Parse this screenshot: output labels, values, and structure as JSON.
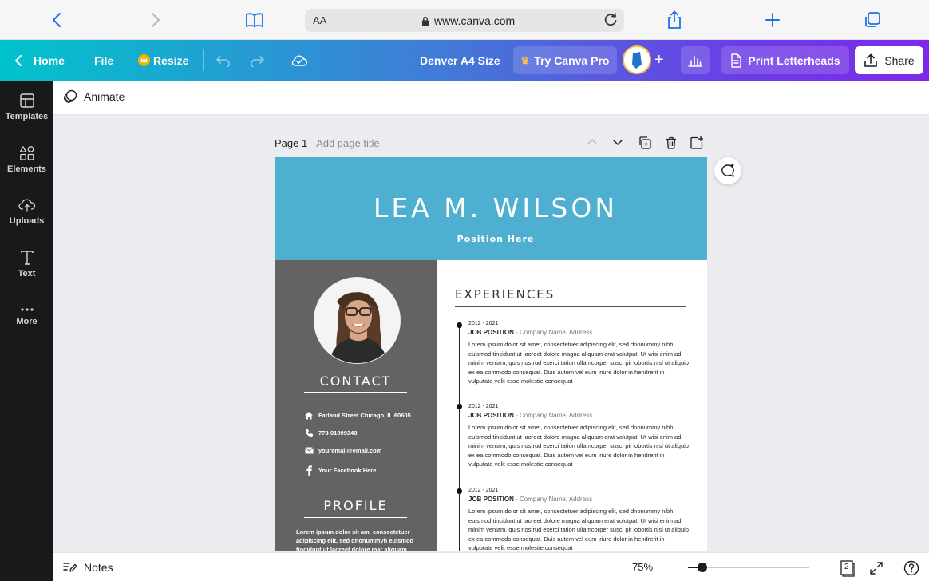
{
  "browser": {
    "aa_label": "AA",
    "url": "www.canva.com"
  },
  "topbar": {
    "home_label": "Home",
    "file_label": "File",
    "resize_label": "Resize",
    "doc_title": "Denver A4 Size",
    "pro_label": "Try Canva Pro",
    "print_label": "Print Letterheads",
    "share_label": "Share"
  },
  "sidebar": {
    "items": [
      {
        "label": "Templates",
        "icon": "templates-icon"
      },
      {
        "label": "Elements",
        "icon": "elements-icon"
      },
      {
        "label": "Uploads",
        "icon": "uploads-icon"
      },
      {
        "label": "Text",
        "icon": "text-icon"
      },
      {
        "label": "More",
        "icon": "more-icon"
      }
    ]
  },
  "toolbar": {
    "animate_label": "Animate"
  },
  "page": {
    "label": "Page 1 -",
    "title_placeholder": "Add page title"
  },
  "resume": {
    "name": "LEA M. WILSON",
    "position": "Position Here",
    "contact_title": "CONTACT",
    "contacts": [
      {
        "icon": "home-icon",
        "text": "Farland Street Chicago, IL 60605"
      },
      {
        "icon": "phone-icon",
        "text": "773-91099348"
      },
      {
        "icon": "email-icon",
        "text": "youremail@email.com"
      },
      {
        "icon": "facebook-icon",
        "text": "Your Facebook Here"
      }
    ],
    "profile_title": "PROFILE",
    "profile_text": "Lorem ipsum dolor sit am, consectetuer adipiscing elit, sed dnonummyh euismod tincidunt ut laoreet dolore mar aliquam",
    "experience_title": "EXPERIENCES",
    "jobs": [
      {
        "years": "2012 - 2021",
        "position": "JOB POSITION",
        "company": " - Company Name, Address",
        "description": "Lorem ipsum dolor sit amet, consectetuer adipiscing elit, sed dnonummy nibh euismod tincidunt ut laoreet dolore magna aliquam erat volutpat. Ut wisi enim ad minim veniam, quis nostrud exerci tation ullamcorper susci pit lobortis nisl ut aliquip ex ea commodo consequat. Duis autem vel eum iriure dolor in hendrerit in vulputate velit esse molestie consequat"
      },
      {
        "years": "2012 - 2021",
        "position": "JOB POSITION",
        "company": " - Company Name, Address",
        "description": "Lorem ipsum dolor sit amet, consectetuer adipiscing elit, sed dnonummy nibh euismod tincidunt ut laoreet dolore magna aliquam erat volutpat. Ut wisi enim ad minim veniam, quis nostrud exerci tation ullamcorper susci pit lobortis nisl ut aliquip ex ea commodo consequat. Duis autem vel eum iriure dolor in hendrerit in vulputate velit esse molestie consequat"
      },
      {
        "years": "2012 - 2021",
        "position": "JOB POSITION",
        "company": " - Company Name, Address",
        "description": "Lorem ipsum dolor sit amet, consectetuer adipiscing elit, sed dnonummy nibh euismod tincidunt ut laoreet dolore magna aliquam erat volutpat. Ut wisi enim ad minim veniam, quis nostrud exerci tation ullamcorper susci pit lobortis nisl ut aliquip ex ea commodo consequat. Duis autem vel eum iriure dolor in hendrerit in vulputate velit esse molestie consequat"
      }
    ]
  },
  "bottombar": {
    "notes_label": "Notes",
    "zoom_label": "75%",
    "zoom_fraction": 0.12,
    "page_count": "2"
  },
  "colors": {
    "header_band": "#4fafd1",
    "left_column": "#636363",
    "sidebar": "#18191b"
  }
}
